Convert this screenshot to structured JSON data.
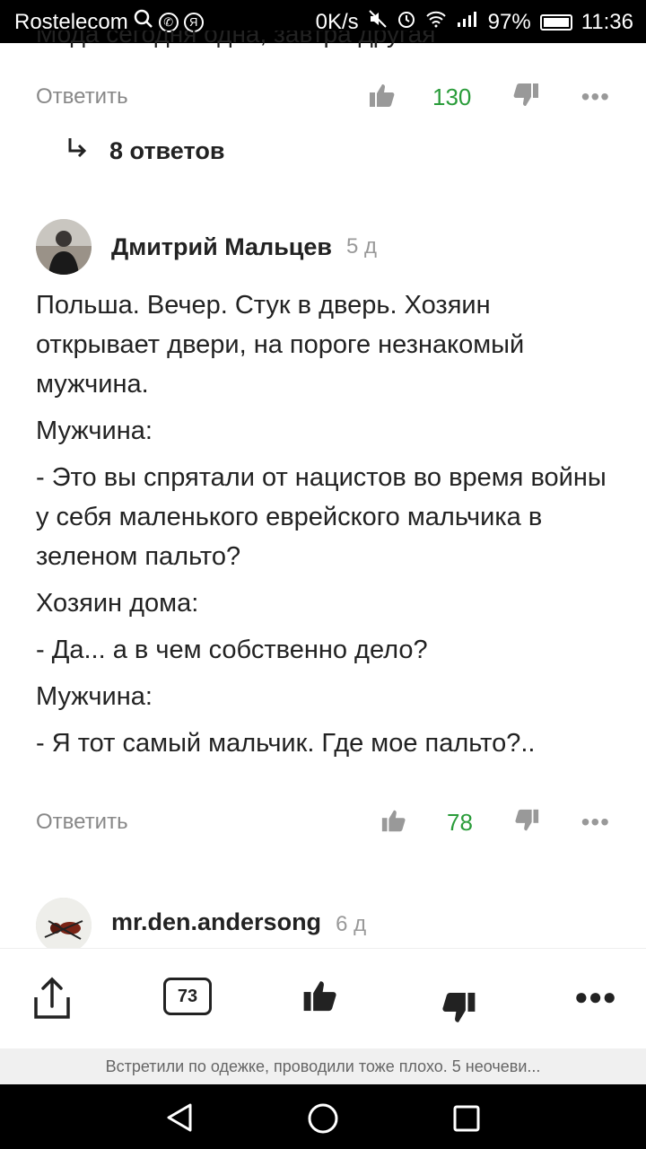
{
  "status_bar": {
    "carrier": "Rostelecom",
    "speed": "0K/s",
    "battery": "97%",
    "time": "11:36"
  },
  "clipped_previous_text": "Мода сегодня одна, завтра другая",
  "prev_comment": {
    "reply_label": "Ответить",
    "likes": "130",
    "replies_link": "8 ответов"
  },
  "comment": {
    "author": "Дмитрий Мальцев",
    "age": "5 д",
    "paragraphs": [
      "Польша. Вечер. Стук в дверь. Хозяин открывает двери, на пороге незнакомый мужчина.",
      "Мужчина:",
      "- Это вы спрятали от нацистов во время войны у себя маленького еврейского мальчика в зеленом пальто?",
      "Хозяин дома:",
      "- Да... а в чем собственно дело?",
      "Мужчина:",
      "- Я тот самый мальчик. Где мое пальто?.."
    ],
    "reply_label": "Ответить",
    "likes": "78"
  },
  "next_comment": {
    "author": "mr.den.andersong",
    "age": "6 д"
  },
  "bottom_bar": {
    "comments_count": "73"
  },
  "preview_text": "Встретили по одежке, проводили тоже плохо. 5 неочеви...",
  "colors": {
    "like_count": "#2a9c3a",
    "muted": "#888888"
  }
}
